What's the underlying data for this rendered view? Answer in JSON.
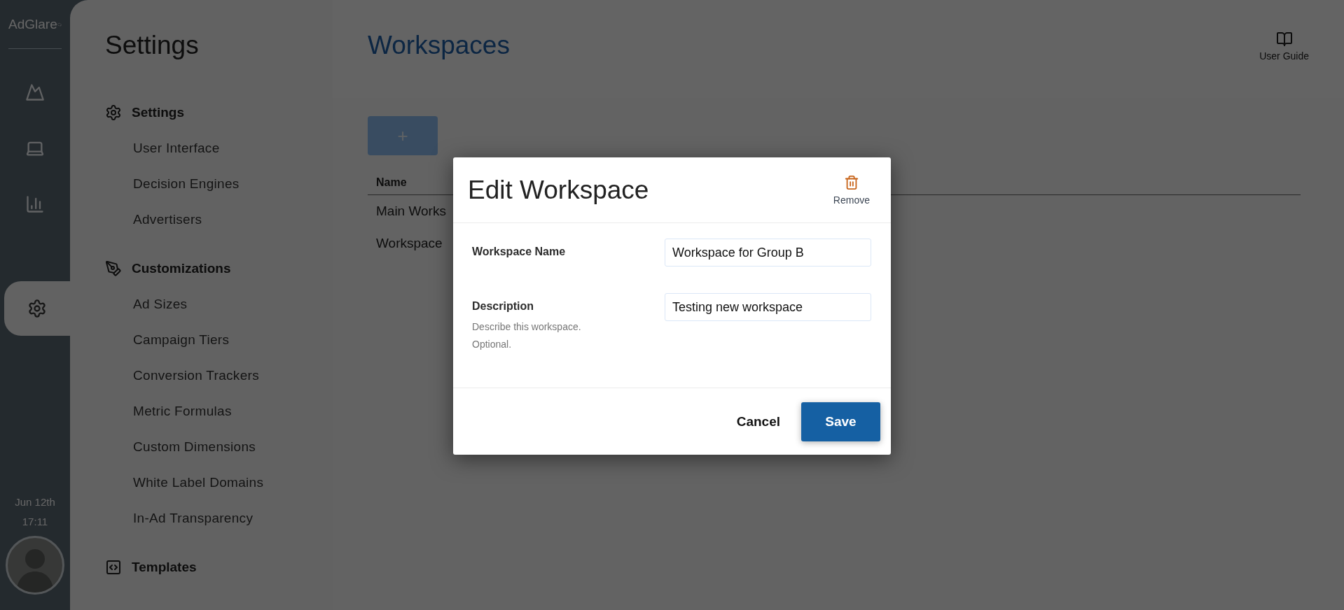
{
  "rail": {
    "logo": "AdGlare",
    "items": [
      {
        "kind": "mountain",
        "selected": false
      },
      {
        "kind": "laptop",
        "selected": false
      },
      {
        "kind": "chart",
        "selected": false
      },
      {
        "kind": "gear",
        "selected": true
      }
    ],
    "date": "Jun 12th",
    "time": "17:11"
  },
  "settings_menu": {
    "title": "Settings",
    "sections": [
      {
        "kind": "gear",
        "label": "Settings",
        "items": [
          "User Interface",
          "Decision Engines",
          "Advertisers"
        ]
      },
      {
        "kind": "pen",
        "label": "Customizations",
        "items": [
          "Ad Sizes",
          "Campaign Tiers",
          "Conversion Trackers",
          "Metric Formulas",
          "Custom Dimensions",
          "White Label Domains",
          "In-Ad Transparency"
        ]
      },
      {
        "kind": "code",
        "label": "Templates"
      }
    ]
  },
  "main": {
    "title": "Workspaces",
    "user_guide": "User Guide",
    "add_button": "+",
    "table": {
      "columns": [
        "Name"
      ],
      "rows": [
        [
          "Main Works"
        ],
        [
          "Workspace"
        ]
      ]
    }
  },
  "dialog": {
    "title": "Edit Workspace",
    "remove": "Remove",
    "fields": [
      {
        "label": "Workspace Name",
        "value": "Workspace for Group B"
      },
      {
        "label": "Description",
        "hint": "Describe this workspace. Optional.",
        "value": "Testing new workspace"
      }
    ],
    "buttons": [
      {
        "label": "Cancel",
        "kind": "secondary"
      },
      {
        "label": "Save",
        "kind": "primary"
      }
    ]
  }
}
